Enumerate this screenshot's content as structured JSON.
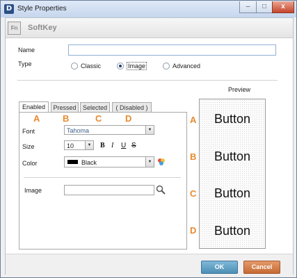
{
  "window": {
    "title": "Style Properties",
    "app_icon": "D",
    "minimize_glyph": "–",
    "maximize_glyph": "□",
    "close_glyph": "x"
  },
  "header": {
    "badge": "Fn",
    "title": "SoftKey"
  },
  "form": {
    "name_label": "Name",
    "name_value": "",
    "type_label": "Type",
    "type_options": [
      {
        "label": "Classic",
        "selected": false
      },
      {
        "label": "Image",
        "selected": true
      },
      {
        "label": "Advanced",
        "selected": false
      }
    ]
  },
  "tabs": [
    {
      "label": "Enabled",
      "marker": "A",
      "active": true
    },
    {
      "label": "Pressed",
      "marker": "B",
      "active": false
    },
    {
      "label": "Selected",
      "marker": "C",
      "active": false
    },
    {
      "label": "( Disabled )",
      "marker": "D",
      "active": false
    }
  ],
  "style": {
    "font_label": "Font",
    "font_value": "Tahoma",
    "size_label": "Size",
    "size_value": "10",
    "bold": "B",
    "italic": "I",
    "underline": "U",
    "strike": "S",
    "color_label": "Color",
    "color_value": "Black",
    "color_hex": "#000000",
    "image_label": "Image",
    "image_value": ""
  },
  "preview": {
    "title": "Preview",
    "items": [
      {
        "marker": "A",
        "label": "Button"
      },
      {
        "marker": "B",
        "label": "Button"
      },
      {
        "marker": "C",
        "label": "Button"
      },
      {
        "marker": "D",
        "label": "Button"
      }
    ]
  },
  "footer": {
    "ok": "OK",
    "cancel": "Cancel"
  },
  "colors": {
    "accent_marker": "#e88a2e",
    "ok_button": "#5a9bc2",
    "cancel_button": "#d2783f"
  }
}
